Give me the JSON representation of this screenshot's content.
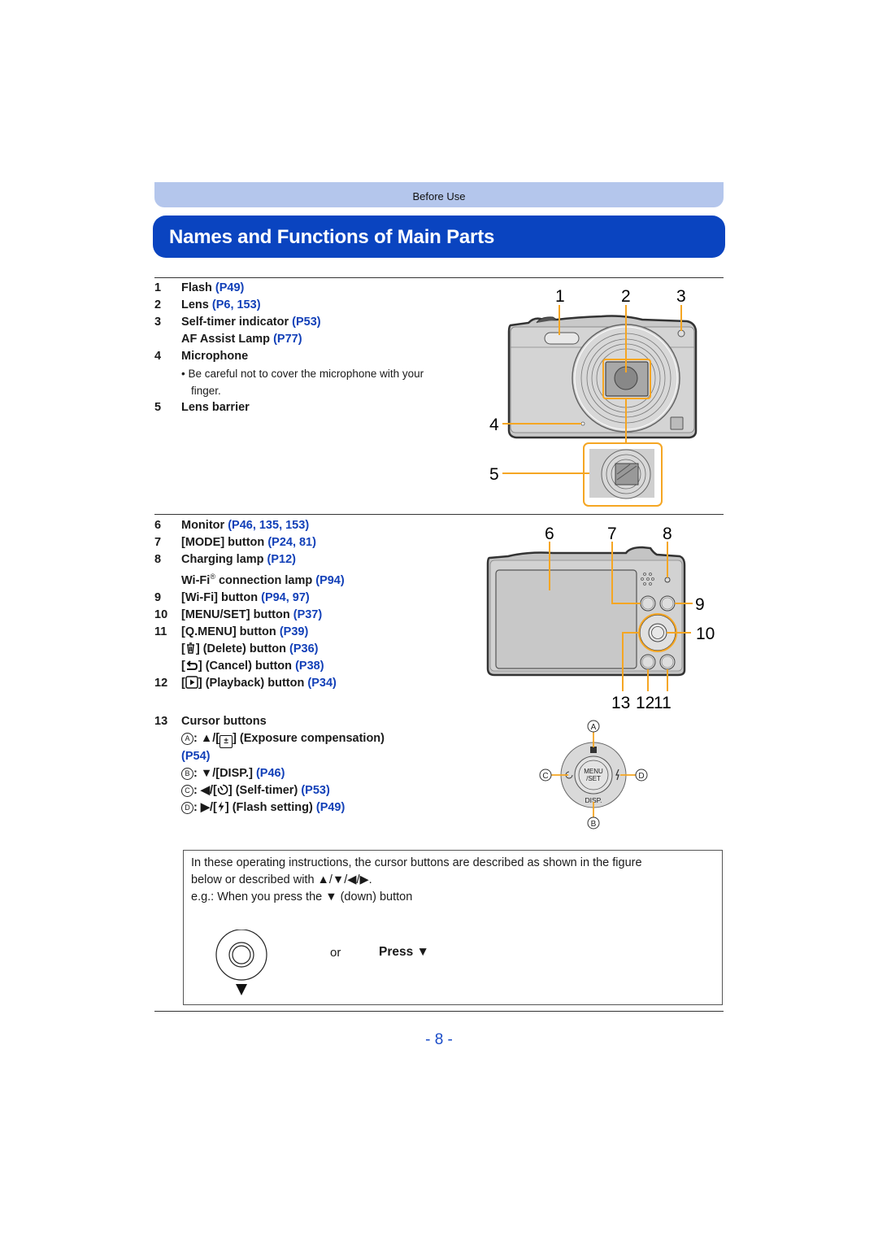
{
  "header": {
    "section_tab": "Before Use",
    "title": "Names and Functions of Main Parts"
  },
  "front_parts": [
    {
      "num": "1",
      "name": "Flash",
      "refs": "(P49)"
    },
    {
      "num": "2",
      "name": "Lens",
      "refs": "(P6, 153)"
    },
    {
      "num": "3",
      "name": "Self-timer indicator",
      "refs": "(P53)"
    },
    {
      "num": "",
      "name": "AF Assist Lamp",
      "refs": "(P77)"
    },
    {
      "num": "4",
      "name": "Microphone",
      "refs": ""
    },
    {
      "num": "5",
      "name": "Lens barrier",
      "refs": ""
    }
  ],
  "microphone_note": "• Be careful not to cover the microphone with your finger.",
  "back_parts": {
    "p6": {
      "num": "6",
      "name": "Monitor",
      "refs": "(P46, 135, 153)"
    },
    "p7": {
      "num": "7",
      "name": "[MODE] button",
      "refs": "(P24, 81)"
    },
    "p8": {
      "num": "8",
      "name": "Charging lamp",
      "refs": "(P12)"
    },
    "p8b": {
      "name_a": "Wi-Fi",
      "reg": "®",
      "name_b": " connection lamp",
      "refs": "(P94)"
    },
    "p9": {
      "num": "9",
      "name": "[Wi-Fi] button",
      "refs": "(P94, 97)"
    },
    "p10": {
      "num": "10",
      "name": "[MENU/SET] button",
      "refs": "(P37)"
    },
    "p11": {
      "num": "11",
      "name": "[Q.MENU] button",
      "refs": "(P39)"
    },
    "p11b": {
      "open": "[",
      "icon": "🗑",
      "close": "] (Delete) button",
      "refs": "(P36)"
    },
    "p11c": {
      "open": "[",
      "icon": "↶",
      "close": "] (Cancel) button",
      "refs": "(P38)"
    },
    "p12": {
      "num": "12",
      "open": "[",
      "icon": "▶",
      "close": "] (Playback) button",
      "refs": "(P34)"
    }
  },
  "cursor": {
    "num": "13",
    "title": "Cursor buttons",
    "a": {
      "letter": "A",
      "text": ": ▲/[",
      "icon": "±",
      "rest": "] (Exposure compensation)",
      "refs": "(P54)"
    },
    "b": {
      "letter": "B",
      "text": ": ▼/[DISP.]",
      "refs": "(P46)"
    },
    "c": {
      "letter": "C",
      "text": ": ◀/[",
      "icon": "⌚",
      "rest": "] (Self-timer)",
      "refs": "(P53)"
    },
    "d": {
      "letter": "D",
      "text": ": ▶/[",
      "icon": "ϟ",
      "rest": "] (Flash setting)",
      "refs": "(P49)"
    }
  },
  "diagram_labels": {
    "front": [
      "1",
      "2",
      "3",
      "4",
      "5"
    ],
    "back": [
      "6",
      "7",
      "8",
      "9",
      "10",
      "11",
      "12",
      "13"
    ],
    "dial": {
      "a": "A",
      "b": "B",
      "c": "C",
      "d": "D",
      "center_line1": "MENU",
      "center_line2": "/SET",
      "bottom": "DISP."
    }
  },
  "info_box": {
    "line1": "In these operating instructions, the cursor buttons are described as shown in the figure",
    "line2": "below or described with ▲/▼/◀/▶.",
    "line3": "e.g.: When you press the ▼ (down) button",
    "or": "or",
    "press": "Press ▼"
  },
  "page_number": "- 8 -",
  "colors": {
    "accent_blue": "#0a44c0",
    "tab_blue": "#b4c6ec",
    "link_blue": "#1240b8",
    "callout_orange": "#f5a623"
  }
}
